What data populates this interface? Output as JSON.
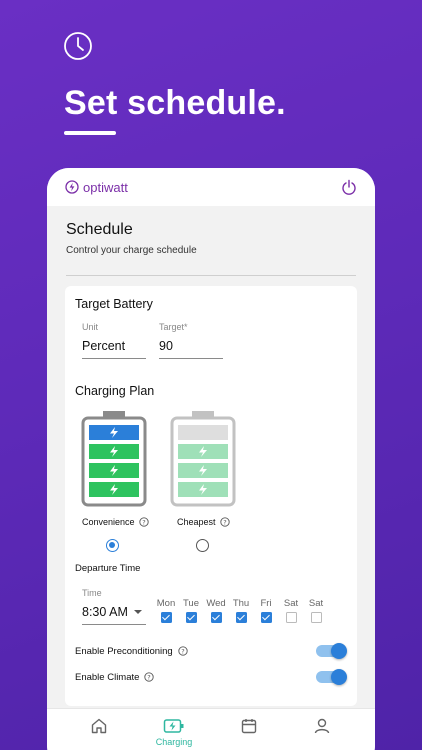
{
  "hero": {
    "icon": "clock-icon",
    "title": "Set schedule."
  },
  "appbar": {
    "brand": "optiwatt",
    "brand_icon": "bolt-circle-icon",
    "power_icon": "power-icon",
    "brand_color": "#7b2fa8"
  },
  "schedule": {
    "title": "Schedule",
    "subtitle": "Control your charge schedule"
  },
  "target_battery": {
    "title": "Target Battery",
    "unit_label": "Unit",
    "unit_value": "Percent",
    "target_label": "Target*",
    "target_value": "90"
  },
  "charging_plan": {
    "title": "Charging Plan",
    "options": [
      {
        "label": "Convenience",
        "selected": true,
        "color": "#2b7fd9"
      },
      {
        "label": "Cheapest",
        "selected": false,
        "color": "#9fe0b8"
      }
    ]
  },
  "departure": {
    "title": "Departure Time",
    "time_label": "Time",
    "time_value": "8:30 AM",
    "days": [
      {
        "label": "Mon",
        "checked": true
      },
      {
        "label": "Tue",
        "checked": true
      },
      {
        "label": "Wed",
        "checked": true
      },
      {
        "label": "Thu",
        "checked": true
      },
      {
        "label": "Fri",
        "checked": true
      },
      {
        "label": "Sat",
        "checked": false
      },
      {
        "label": "Sat",
        "checked": false
      }
    ]
  },
  "toggles": {
    "preconditioning": {
      "label": "Enable Preconditioning",
      "on": true
    },
    "climate": {
      "label": "Enable Climate",
      "on": true
    }
  },
  "tabbar": {
    "active_color": "#2fb7a0",
    "tabs": [
      {
        "icon": "home-icon",
        "label": ""
      },
      {
        "icon": "charging-icon",
        "label": "Charging"
      },
      {
        "icon": "calendar-icon",
        "label": ""
      },
      {
        "icon": "profile-icon",
        "label": ""
      }
    ]
  }
}
